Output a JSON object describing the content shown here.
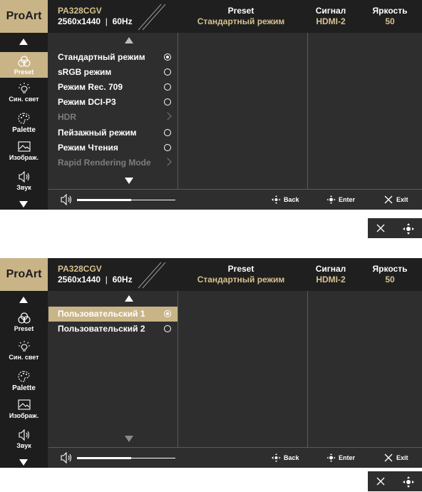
{
  "header": {
    "logo": "ProArt",
    "model": "PA328CGV",
    "resolution": "2560x1440",
    "refresh": "60Hz",
    "preset_label": "Preset",
    "preset_value": "Стандартный режим",
    "signal_label": "Сигнал",
    "signal_value": "HDMI-2",
    "brightness_label": "Яркость",
    "brightness_value": "50"
  },
  "sidebar": {
    "items": [
      {
        "label": "Preset",
        "icon": "preset-icon",
        "selected": true
      },
      {
        "label": "Син. свет",
        "icon": "blue-light-icon"
      },
      {
        "label": "Palette",
        "icon": "palette-icon"
      },
      {
        "label": "Изображ.",
        "icon": "image-icon"
      },
      {
        "label": "Звук",
        "icon": "speaker-icon"
      }
    ]
  },
  "menu1": {
    "items": [
      {
        "label": "Стандартный режим",
        "type": "radio",
        "checked": true
      },
      {
        "label": "sRGB режим",
        "type": "radio"
      },
      {
        "label": "Режим Rec. 709",
        "type": "radio"
      },
      {
        "label": "Режим DCI-P3",
        "type": "radio"
      },
      {
        "label": "HDR",
        "type": "submenu",
        "disabled": true
      },
      {
        "label": "Пейзажный режим",
        "type": "radio"
      },
      {
        "label": "Режим Чтения",
        "type": "radio"
      },
      {
        "label": "Rapid Rendering Mode",
        "type": "submenu",
        "disabled": true
      }
    ]
  },
  "menu2": {
    "items": [
      {
        "label": "Пользовательский 1",
        "type": "radio",
        "checked": true,
        "selected": true
      },
      {
        "label": "Пользовательский 2",
        "type": "radio"
      }
    ]
  },
  "footer": {
    "volume_level": 0.55,
    "back_label": "Back",
    "enter_label": "Enter",
    "exit_label": "Exit"
  },
  "colors": {
    "accent": "#c9b487",
    "panel": "#2e2e2e",
    "header": "#1f1f1f",
    "disabled": "#7d7d7d"
  }
}
